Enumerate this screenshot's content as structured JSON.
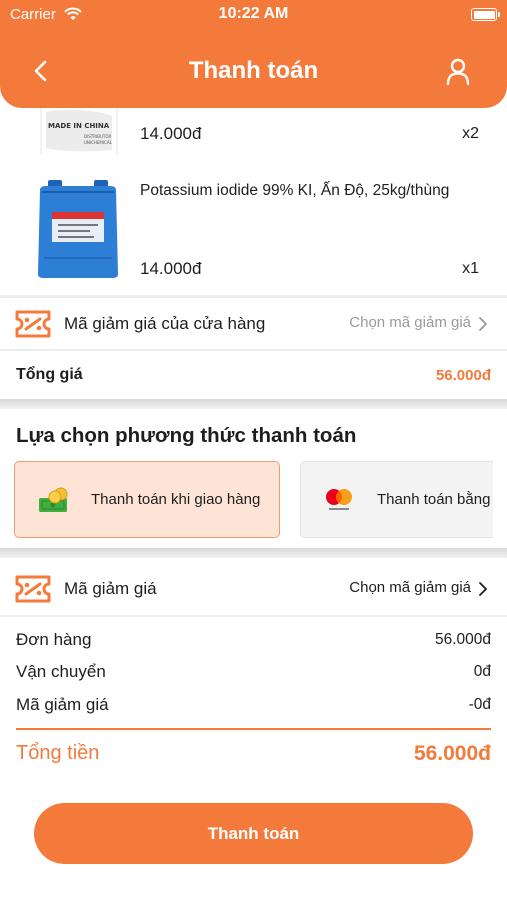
{
  "status_bar": {
    "carrier": "Carrier",
    "time": "10:22 AM"
  },
  "header": {
    "title": "Thanh toán"
  },
  "products": [
    {
      "price": "14.000đ",
      "qty": "x2",
      "label_text": "MADE IN CHINA"
    },
    {
      "name": "Potassium iodide 99% KI, Ấn Độ, 25kg/thùng",
      "price": "14.000đ",
      "qty": "x1"
    }
  ],
  "shop_voucher": {
    "label": "Mã giảm giá của cửa hàng",
    "action": "Chọn mã giảm giá"
  },
  "subtotal": {
    "label": "Tổng giá",
    "value": "56.000đ"
  },
  "payment": {
    "title": "Lựa chọn phương thức thanh toán",
    "options": [
      {
        "label": "Thanh toán khi giao hàng",
        "icon": "cash-icon",
        "selected": true
      },
      {
        "label": "Thanh toán bằng",
        "icon": "mastercard-icon",
        "selected": false
      }
    ]
  },
  "voucher": {
    "label": "Mã giảm giá",
    "action": "Chọn mã giảm giá"
  },
  "summary": [
    {
      "label": "Đơn hàng",
      "value": "56.000đ"
    },
    {
      "label": "Vận chuyển",
      "value": "0đ"
    },
    {
      "label": "Mã giảm giá",
      "value": "-0đ"
    }
  ],
  "grand_total": {
    "label": "Tổng tiền",
    "value": "56.000đ"
  },
  "checkout_button": {
    "label": "Thanh toán"
  },
  "colors": {
    "accent": "#f47a3c",
    "selected_bg": "#fde4d6",
    "muted": "#9a9a9a"
  }
}
